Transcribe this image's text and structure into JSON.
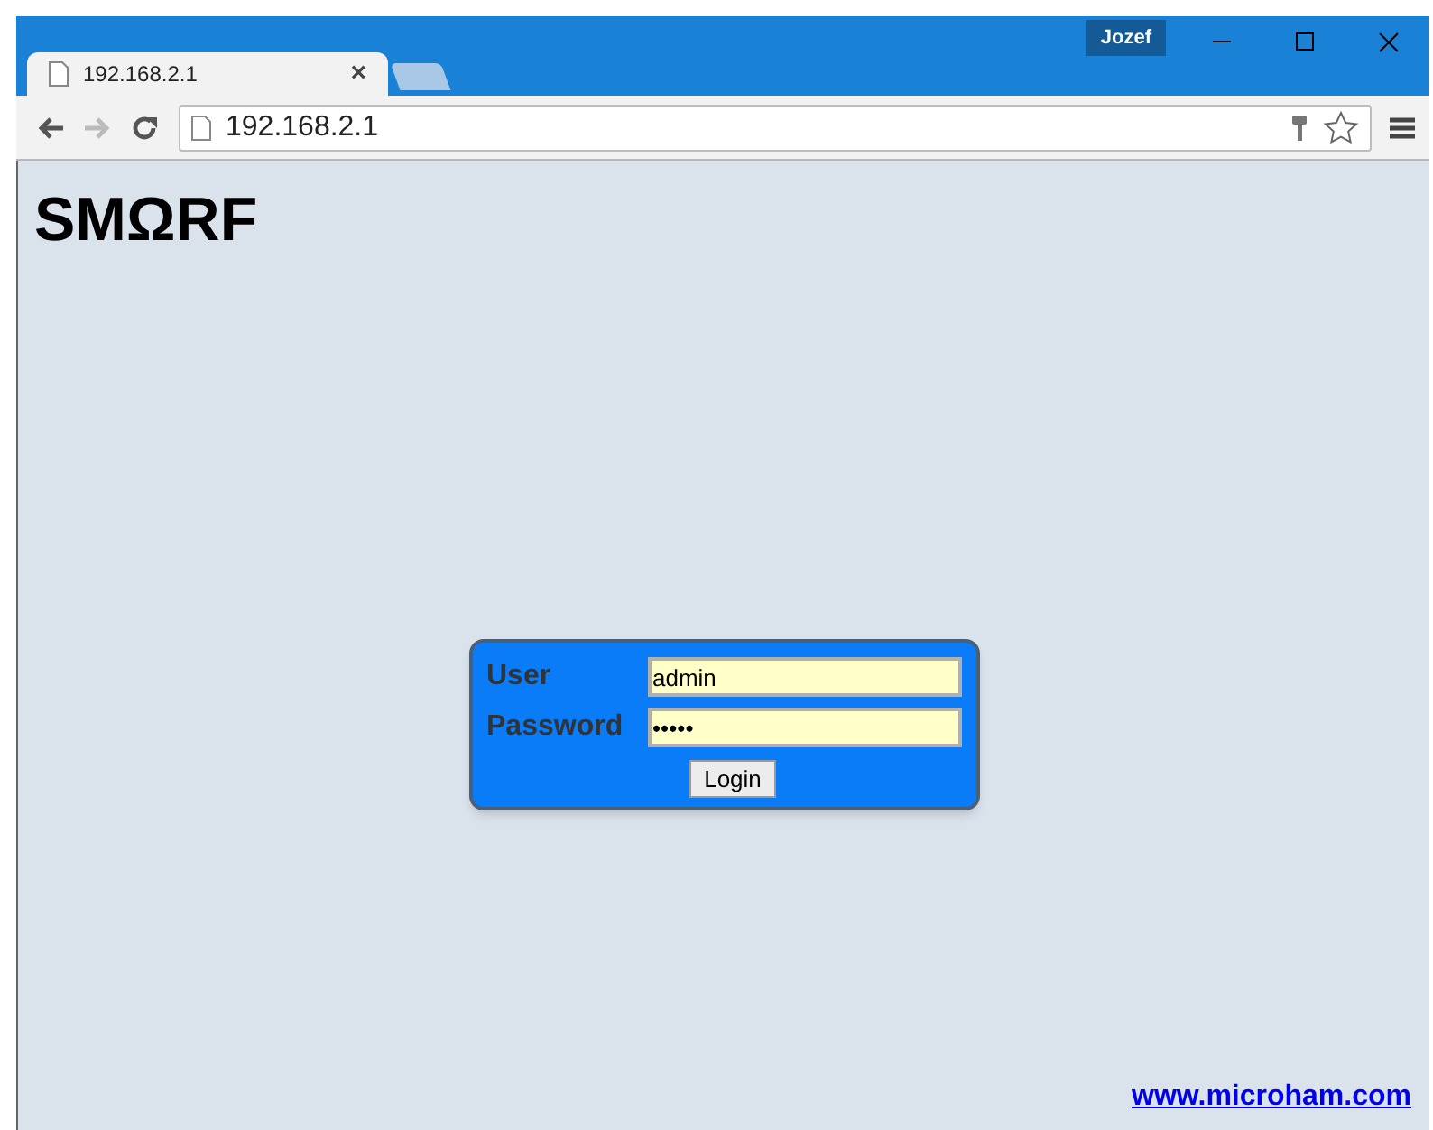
{
  "window": {
    "profile": "Jozef"
  },
  "tabs": [
    {
      "title": "192.168.2.1",
      "selected": true,
      "close": "×"
    }
  ],
  "address_bar": {
    "url": "192.168.2.1"
  },
  "page": {
    "heading": "SMΩRF",
    "login": {
      "fields": [
        {
          "label": "User",
          "value": "admin"
        },
        {
          "label": "Password",
          "value": "•••••"
        }
      ],
      "button": "Login"
    },
    "footer_link": "www.microham.com"
  }
}
